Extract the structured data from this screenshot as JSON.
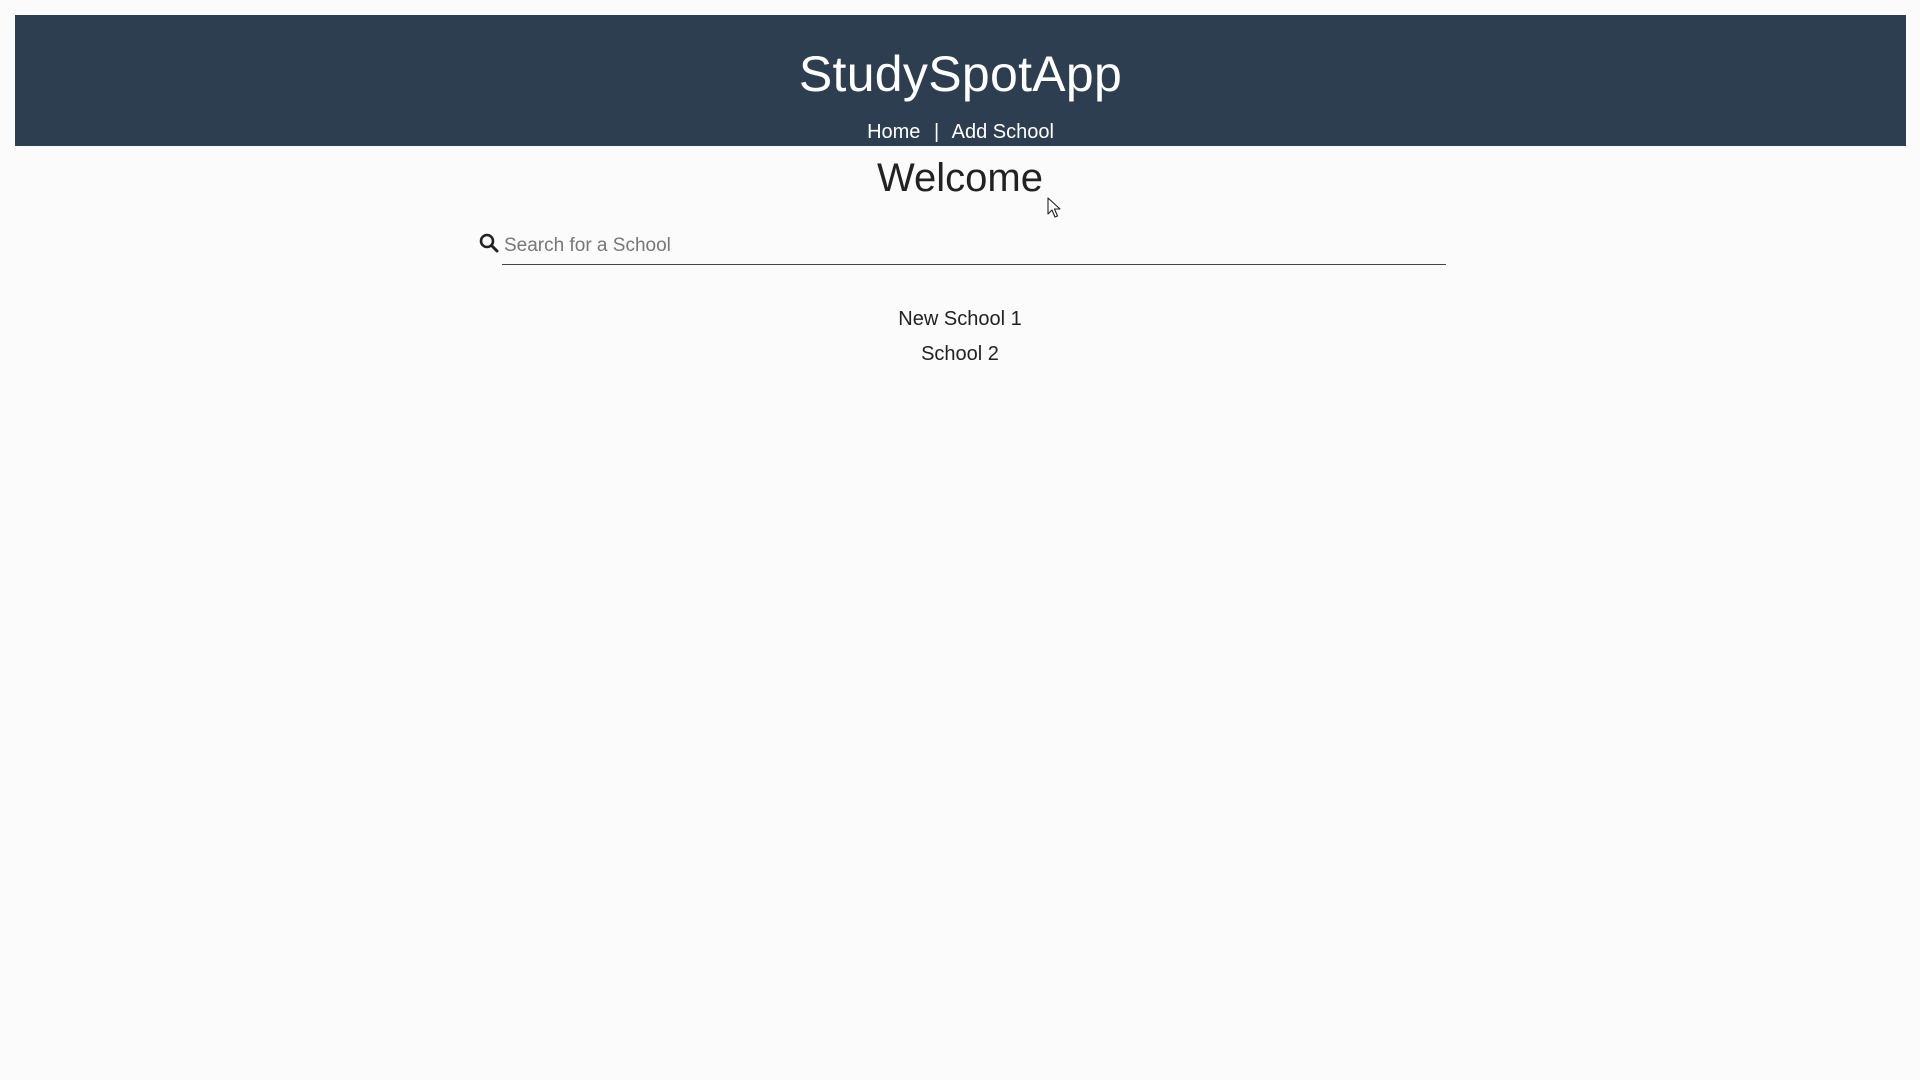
{
  "header": {
    "app_title": "StudySpotApp",
    "nav": {
      "home_label": "Home",
      "separator": "|",
      "add_school_label": "Add School"
    },
    "background_color": "#2d3e50"
  },
  "main": {
    "heading": "Welcome",
    "search": {
      "placeholder": "Search for a School",
      "value": "",
      "icon": "search-icon"
    },
    "schools": [
      {
        "name": "New School 1"
      },
      {
        "name": "School 2"
      }
    ]
  }
}
